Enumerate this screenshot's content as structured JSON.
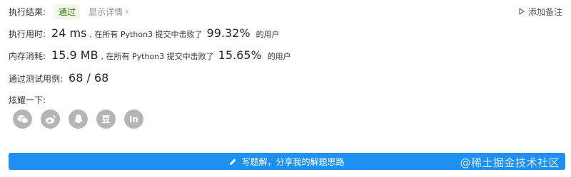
{
  "result": {
    "label": "执行结果:",
    "status": "通过",
    "details_link": "显示详情",
    "add_note": "添加备注"
  },
  "runtime": {
    "label": "执行用时:",
    "value": "24 ms",
    "sentence": ", 在所有 Python3 提交中击败了",
    "percent": "99.32%",
    "users": "的用户"
  },
  "memory": {
    "label": "内存消耗:",
    "value": "15.9 MB",
    "sentence": ", 在所有 Python3 提交中击败了",
    "percent": "15.65%",
    "users": "的用户"
  },
  "tests": {
    "label": "通过测试用例:",
    "value": "68 / 68"
  },
  "share": {
    "label": "炫耀一下:",
    "icons": [
      "wechat-icon",
      "weibo-icon",
      "qq-icon",
      "douban-icon",
      "linkedin-icon"
    ],
    "douban_text": "豆",
    "linkedin_text": "in"
  },
  "write_solution": {
    "label": "写题解，分享我的解题思路"
  },
  "watermark": "@稀土掘金技术社区",
  "colors": {
    "accent": "#1f8ff0",
    "pass_bg": "#f3f8e6",
    "pass_text": "#3d7a1a",
    "icon_bg": "#b5b5b5"
  }
}
